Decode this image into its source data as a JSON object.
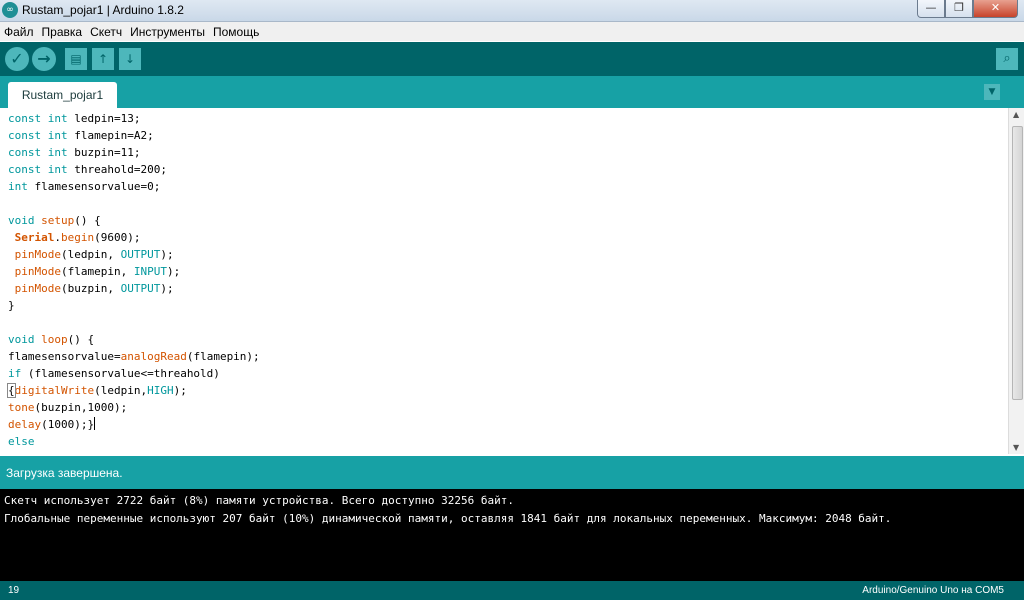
{
  "window": {
    "title": "Rustam_pojar1 | Arduino 1.8.2",
    "app_icon": "∞",
    "controls": {
      "minimize": "—",
      "maximize": "❐",
      "close": "✕"
    }
  },
  "menu": [
    "Файл",
    "Правка",
    "Скетч",
    "Инструменты",
    "Помощь"
  ],
  "toolbar": {
    "verify_icon": "✓",
    "upload_icon": "→",
    "new_icon": "▤",
    "open_icon": "↑",
    "save_icon": "↓",
    "serial_monitor_icon": "⌕"
  },
  "tabs": {
    "active": "Rustam_pojar1",
    "menu_icon": "▼"
  },
  "code": [
    [
      [
        "kw",
        "const"
      ],
      [
        "t",
        " "
      ],
      [
        "kw",
        "int"
      ],
      [
        "t",
        " ledpin=13;"
      ]
    ],
    [
      [
        "kw",
        "const"
      ],
      [
        "t",
        " "
      ],
      [
        "kw",
        "int"
      ],
      [
        "t",
        " flamepin=A2;"
      ]
    ],
    [
      [
        "kw",
        "const"
      ],
      [
        "t",
        " "
      ],
      [
        "kw",
        "int"
      ],
      [
        "t",
        " buzpin=11;"
      ]
    ],
    [
      [
        "kw",
        "const"
      ],
      [
        "t",
        " "
      ],
      [
        "kw",
        "int"
      ],
      [
        "t",
        " threahold=200;"
      ]
    ],
    [
      [
        "kw",
        "int"
      ],
      [
        "t",
        " flamesensorvalue=0;"
      ]
    ],
    [],
    [
      [
        "kw",
        "void"
      ],
      [
        "t",
        " "
      ],
      [
        "fn",
        "setup"
      ],
      [
        "t",
        "() {"
      ]
    ],
    [
      [
        "t",
        " "
      ],
      [
        "cls",
        "Serial"
      ],
      [
        "t",
        "."
      ],
      [
        "fn",
        "begin"
      ],
      [
        "t",
        "(9600);"
      ]
    ],
    [
      [
        "t",
        " "
      ],
      [
        "fn",
        "pinMode"
      ],
      [
        "t",
        "(ledpin, "
      ],
      [
        "cst",
        "OUTPUT"
      ],
      [
        "t",
        ");"
      ]
    ],
    [
      [
        "t",
        " "
      ],
      [
        "fn",
        "pinMode"
      ],
      [
        "t",
        "(flamepin, "
      ],
      [
        "cst",
        "INPUT"
      ],
      [
        "t",
        ");"
      ]
    ],
    [
      [
        "t",
        " "
      ],
      [
        "fn",
        "pinMode"
      ],
      [
        "t",
        "(buzpin, "
      ],
      [
        "cst",
        "OUTPUT"
      ],
      [
        "t",
        ");"
      ]
    ],
    [
      [
        "t",
        "}"
      ]
    ],
    [],
    [
      [
        "kw",
        "void"
      ],
      [
        "t",
        " "
      ],
      [
        "fn",
        "loop"
      ],
      [
        "t",
        "() {"
      ]
    ],
    [
      [
        "t",
        "flamesensorvalue="
      ],
      [
        "fn",
        "analogRead"
      ],
      [
        "t",
        "(flamepin);"
      ]
    ],
    [
      [
        "kw",
        "if"
      ],
      [
        "t",
        " (flamesensorvalue<=threahold)"
      ]
    ],
    [
      [
        "br",
        "{"
      ],
      [
        "fn",
        "digitalWrite"
      ],
      [
        "t",
        "(ledpin,"
      ],
      [
        "cst",
        "HIGH"
      ],
      [
        "t",
        ");"
      ]
    ],
    [
      [
        "fn",
        "tone"
      ],
      [
        "t",
        "(buzpin,1000);"
      ]
    ],
    [
      [
        "fn",
        "delay"
      ],
      [
        "t",
        "(1000);}"
      ],
      [
        "cur",
        ""
      ]
    ],
    [
      [
        "kw",
        "else"
      ]
    ]
  ],
  "status": {
    "message": "Загрузка завершена."
  },
  "console": [
    "Скетч использует 2722 байт (8%) памяти устройства. Всего доступно 32256 байт.",
    "Глобальные переменные используют 207 байт (10%) динамической памяти, оставляя 1841 байт для локальных переменных. Максимум: 2048 байт."
  ],
  "footer": {
    "line_number": "19",
    "board": "Arduino/Genuino Uno на COM5"
  }
}
